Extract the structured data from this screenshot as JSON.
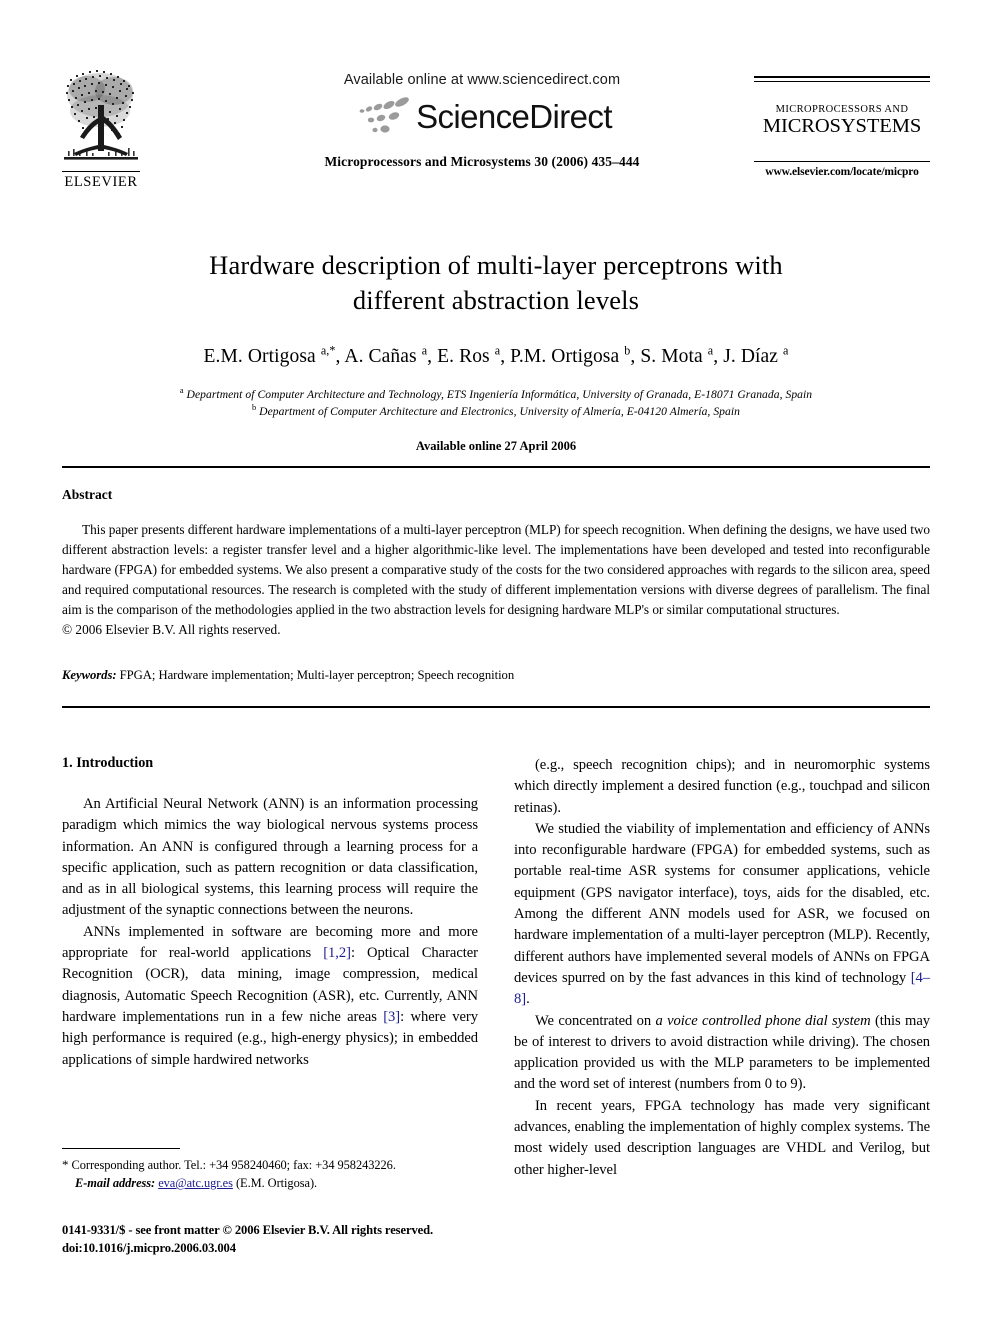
{
  "header": {
    "elsevier_label": "ELSEVIER",
    "elsevier_logo_icon": "elsevier-tree-icon",
    "available_online": "Available online at www.sciencedirect.com",
    "sciencedirect_wordmark": "ScienceDirect",
    "sciencedirect_dots_icon": "sciencedirect-swoosh-icon",
    "journal_citation": "Microprocessors and Microsystems 30 (2006) 435–444",
    "journal_logo_line1": "MICROPROCESSORS AND",
    "journal_logo_line2": "MICROSYSTEMS",
    "journal_url": "www.elsevier.com/locate/micpro"
  },
  "title": {
    "line1": "Hardware description of multi-layer perceptrons with",
    "line2": "different abstraction levels"
  },
  "authors": {
    "list": [
      {
        "name": "E.M. Ortigosa",
        "sup": "a,*"
      },
      {
        "name": "A. Cañas",
        "sup": "a"
      },
      {
        "name": "E. Ros",
        "sup": "a"
      },
      {
        "name": "P.M. Ortigosa",
        "sup": "b"
      },
      {
        "name": "S. Mota",
        "sup": "a"
      },
      {
        "name": "J. Díaz",
        "sup": "a"
      }
    ]
  },
  "affiliations": [
    {
      "marker": "a",
      "text": "Department of Computer Architecture and Technology, ETS Ingeniería Informática, University of Granada, E-18071 Granada, Spain"
    },
    {
      "marker": "b",
      "text": "Department of Computer Architecture and Electronics, University of Almería, E-04120 Almería, Spain"
    }
  ],
  "available_online_date": "Available online 27 April 2006",
  "abstract": {
    "heading": "Abstract",
    "text": "This paper presents different hardware implementations of a multi-layer perceptron (MLP) for speech recognition. When defining the designs, we have used two different abstraction levels: a register transfer level and a higher algorithmic-like level. The implementations have been developed and tested into reconfigurable hardware (FPGA) for embedded systems. We also present a comparative study of the costs for the two considered approaches with regards to the silicon area, speed and required computational resources. The research is completed with the study of different implementation versions with diverse degrees of parallelism. The final aim is the comparison of the methodologies applied in the two abstraction levels for designing hardware MLP's or similar computational structures.",
    "copyright": "© 2006 Elsevier B.V. All rights reserved."
  },
  "keywords": {
    "label": "Keywords:",
    "text": "FPGA; Hardware implementation; Multi-layer perceptron; Speech recognition"
  },
  "body": {
    "section_heading": "1. Introduction",
    "left_paragraphs": [
      "An Artificial Neural Network (ANN) is an information processing paradigm which mimics the way biological nervous systems process information. An ANN is configured through a learning process for a specific application, such as pattern recognition or data classification, and as in all biological systems, this learning process will require the adjustment of the synaptic connections between the neurons.",
      "ANNs implemented in software are becoming more and more appropriate for real-world applications [1,2]: Optical Character Recognition (OCR), data mining, image compression, medical diagnosis, Automatic Speech Recognition (ASR), etc. Currently, ANN hardware implementations run in a few niche areas [3]: where very high performance is required (e.g., high-energy physics); in embedded applications of simple hardwired networks"
    ],
    "right_paragraphs": [
      "(e.g., speech recognition chips); and in neuromorphic systems which directly implement a desired function (e.g., touchpad and silicon retinas).",
      "We studied the viability of implementation and efficiency of ANNs into reconfigurable hardware (FPGA) for embedded systems, such as portable real-time ASR systems for consumer applications, vehicle equipment (GPS navigator interface), toys, aids for the disabled, etc. Among the different ANN models used for ASR, we focused on hardware implementation of a multi-layer perceptron (MLP). Recently, different authors have implemented several models of ANNs on FPGA devices spurred on by the fast advances in this kind of technology [4–8].",
      "We concentrated on a voice controlled phone dial system (this may be of interest to drivers to avoid distraction while driving). The chosen application provided us with the MLP parameters to be implemented and the word set of interest (numbers from 0 to 9).",
      "In recent years, FPGA technology has made very significant advances, enabling the implementation of highly complex systems. The most widely used description languages are VHDL and Verilog, but other higher-level"
    ],
    "citations": {
      "c1": "[1,2]",
      "c2": "[3]",
      "c3": "[4–8]"
    },
    "italic_phrase": "a voice controlled phone dial system"
  },
  "footnotes": {
    "star": "*",
    "corresponding": "Corresponding author. Tel.: +34 958240460; fax: +34 958243226.",
    "email_label": "E-mail address:",
    "email": "eva@atc.ugr.es",
    "email_owner": "(E.M. Ortigosa)."
  },
  "imprint": {
    "line1": "0141-9331/$ - see front matter © 2006 Elsevier B.V. All rights reserved.",
    "line2": "doi:10.1016/j.micpro.2006.03.004"
  }
}
